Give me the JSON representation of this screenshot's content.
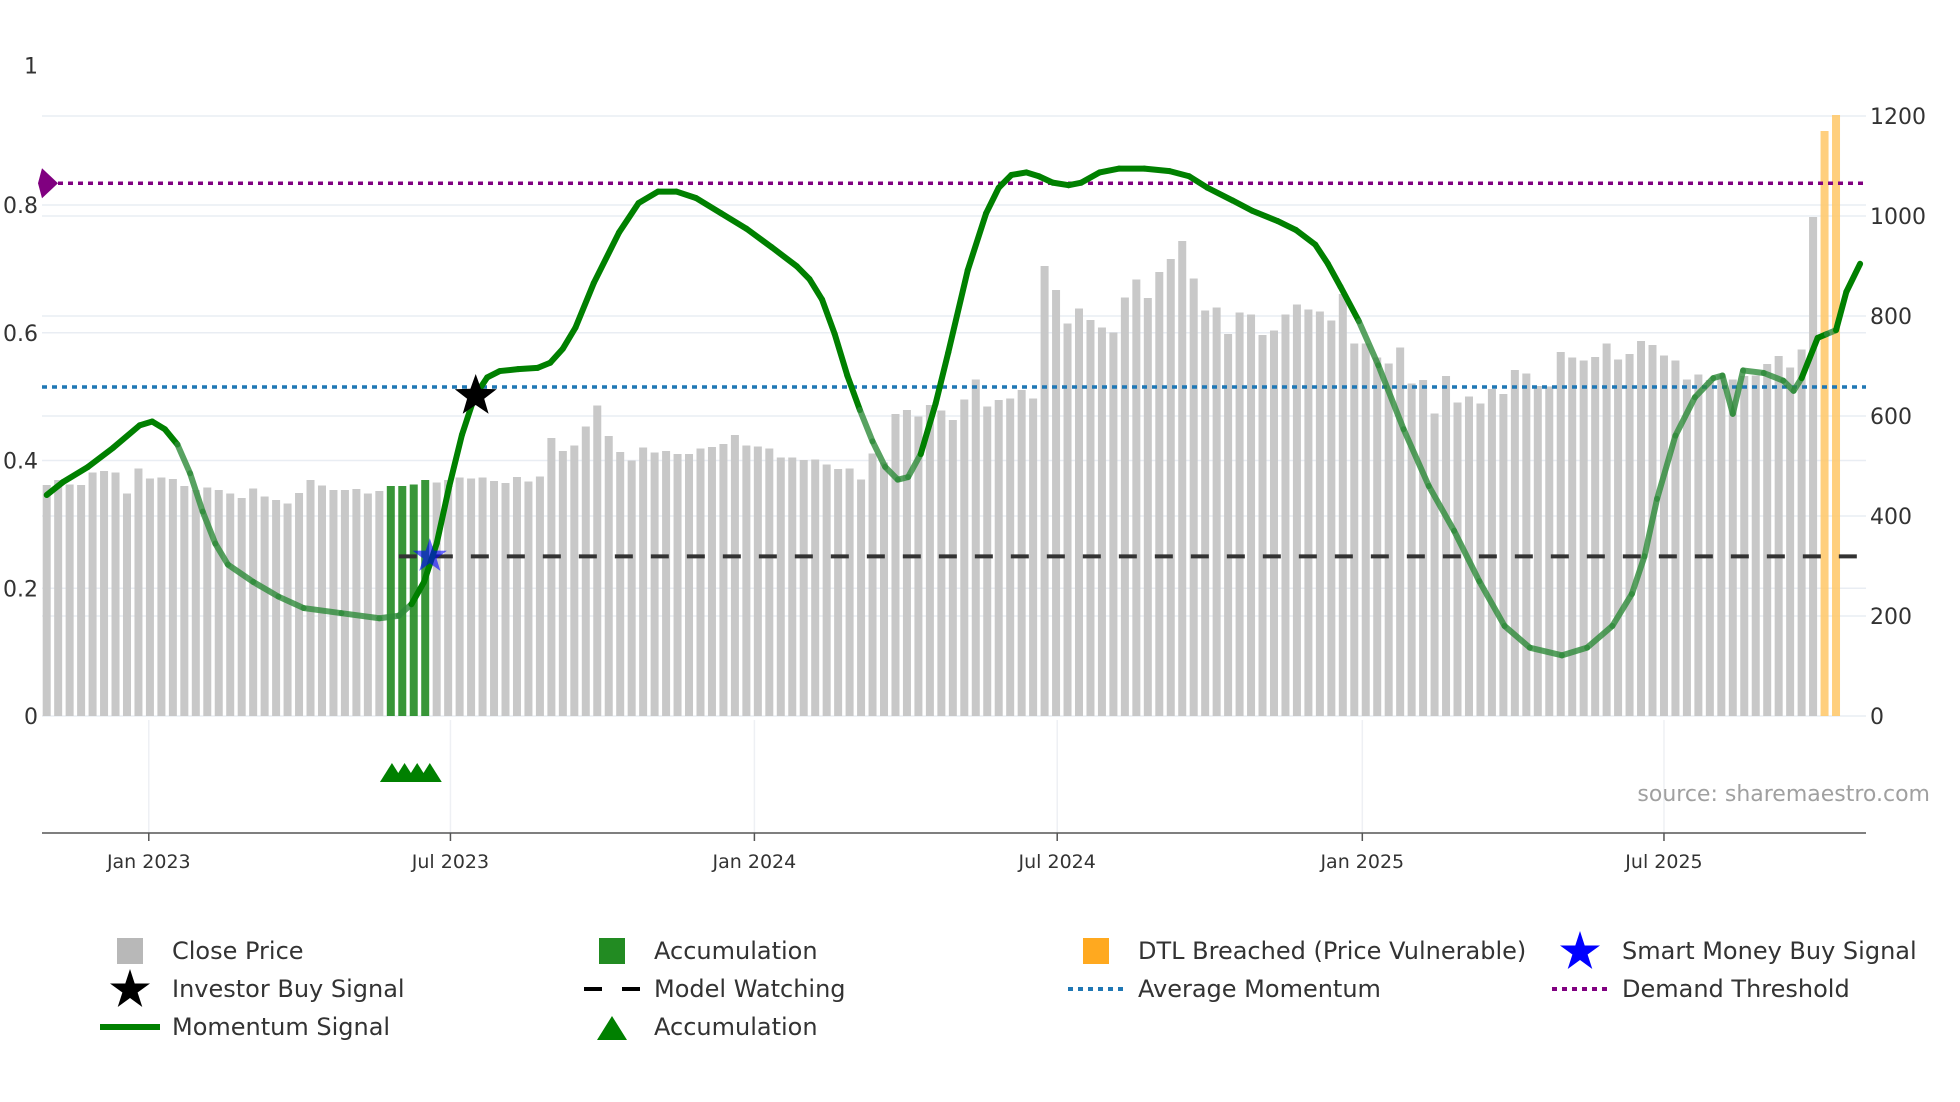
{
  "chart_data": {
    "type": "bar+line",
    "title": "",
    "left_axis": {
      "ticks": [
        "0",
        "0.2",
        "0.4",
        "0.6",
        "0.8",
        "1"
      ],
      "values": [
        0,
        0.2,
        0.4,
        0.6,
        0.8,
        1
      ],
      "range": [
        0,
        1
      ]
    },
    "right_axis": {
      "ticks": [
        "0",
        "200",
        "400",
        "600",
        "800",
        "1000",
        "1200"
      ],
      "values": [
        0,
        200,
        400,
        600,
        800,
        1000,
        1200
      ],
      "range": [
        0,
        1200
      ]
    },
    "x_ticks": [
      {
        "label": "Jan 2023",
        "week": 8.9
      },
      {
        "label": "Jul 2023",
        "week": 35.2
      },
      {
        "label": "Jan 2024",
        "week": 61.7
      },
      {
        "label": "Jul 2024",
        "week": 88.1
      },
      {
        "label": "Jan 2025",
        "week": 114.7
      },
      {
        "label": "Jul 2025",
        "week": 141
      }
    ],
    "close_price": [
      462,
      472,
      463,
      462,
      487,
      490,
      487,
      445,
      495,
      475,
      477,
      474,
      460,
      452,
      457,
      452,
      445,
      436,
      455,
      439,
      432,
      425,
      446,
      472,
      461,
      452,
      452,
      454,
      445,
      450,
      460,
      460,
      463,
      472,
      467,
      472,
      477,
      475,
      477,
      470,
      466,
      478,
      469,
      479,
      556,
      530,
      541,
      579,
      621,
      560,
      528,
      511,
      537,
      527,
      530,
      524,
      524,
      535,
      538,
      544,
      562,
      541,
      539,
      535,
      517,
      517,
      512,
      513,
      503,
      494,
      495,
      473,
      525,
      507,
      604,
      612,
      599,
      622,
      611,
      592,
      633,
      673,
      619,
      632,
      635,
      652,
      635,
      900,
      852,
      785,
      815,
      792,
      777,
      767,
      837,
      873,
      836,
      888,
      914,
      950,
      875,
      811,
      817,
      764,
      807,
      803,
      762,
      771,
      803,
      823,
      813,
      809,
      791,
      844,
      745,
      745,
      717,
      705,
      737,
      665,
      672,
      605,
      680,
      627,
      639,
      625,
      654,
      644,
      692,
      685,
      660,
      659,
      728,
      717,
      711,
      718,
      745,
      713,
      724,
      750,
      742,
      721,
      711,
      673,
      683,
      672,
      681,
      673,
      680,
      681,
      704,
      720,
      697,
      733,
      998,
      1170,
      1202
    ],
    "accumulation_bars": [
      30,
      31,
      32,
      33
    ],
    "dtl_breached_bars": [
      155,
      156
    ],
    "momentum_signal": [
      [
        0,
        0.346
      ],
      [
        1.4,
        0.366
      ],
      [
        3.6,
        0.39
      ],
      [
        5.8,
        0.42
      ],
      [
        8.1,
        0.455
      ],
      [
        9.2,
        0.461
      ],
      [
        10.3,
        0.449
      ],
      [
        11.4,
        0.425
      ],
      [
        12.5,
        0.38
      ],
      [
        13.6,
        0.32
      ],
      [
        14.7,
        0.27
      ],
      [
        15.8,
        0.237
      ],
      [
        18,
        0.21
      ],
      [
        20.2,
        0.187
      ],
      [
        22.4,
        0.169
      ],
      [
        25.7,
        0.161
      ],
      [
        29,
        0.153
      ],
      [
        30.7,
        0.157
      ],
      [
        31.8,
        0.175
      ],
      [
        32.9,
        0.21
      ],
      [
        34,
        0.27
      ],
      [
        35.1,
        0.36
      ],
      [
        36.2,
        0.44
      ],
      [
        37.3,
        0.5
      ],
      [
        38.4,
        0.53
      ],
      [
        39.5,
        0.54
      ],
      [
        41.1,
        0.543
      ],
      [
        42.8,
        0.545
      ],
      [
        43.9,
        0.553
      ],
      [
        45,
        0.575
      ],
      [
        46.1,
        0.608
      ],
      [
        47.7,
        0.678
      ],
      [
        49.9,
        0.757
      ],
      [
        51.6,
        0.803
      ],
      [
        53.3,
        0.821
      ],
      [
        54.9,
        0.821
      ],
      [
        56.6,
        0.811
      ],
      [
        58.8,
        0.787
      ],
      [
        61,
        0.763
      ],
      [
        63.2,
        0.734
      ],
      [
        65.4,
        0.704
      ],
      [
        66.5,
        0.684
      ],
      [
        67.6,
        0.652
      ],
      [
        68.7,
        0.598
      ],
      [
        69.8,
        0.533
      ],
      [
        70.9,
        0.479
      ],
      [
        72,
        0.43
      ],
      [
        73.1,
        0.39
      ],
      [
        74.2,
        0.37
      ],
      [
        75.1,
        0.374
      ],
      [
        76.2,
        0.41
      ],
      [
        77.5,
        0.489
      ],
      [
        78.6,
        0.569
      ],
      [
        80.3,
        0.698
      ],
      [
        81.9,
        0.787
      ],
      [
        83,
        0.827
      ],
      [
        84.1,
        0.847
      ],
      [
        85.4,
        0.851
      ],
      [
        86.5,
        0.845
      ],
      [
        87.7,
        0.835
      ],
      [
        89.1,
        0.831
      ],
      [
        90.2,
        0.835
      ],
      [
        91.8,
        0.851
      ],
      [
        93.5,
        0.857
      ],
      [
        95.7,
        0.857
      ],
      [
        97.9,
        0.853
      ],
      [
        99.6,
        0.845
      ],
      [
        101.2,
        0.827
      ],
      [
        103.4,
        0.807
      ],
      [
        105.1,
        0.791
      ],
      [
        107.3,
        0.775
      ],
      [
        108.9,
        0.761
      ],
      [
        110.6,
        0.738
      ],
      [
        111.7,
        0.708
      ],
      [
        112.8,
        0.672
      ],
      [
        114.4,
        0.618
      ],
      [
        116.1,
        0.549
      ],
      [
        118.3,
        0.449
      ],
      [
        120.5,
        0.36
      ],
      [
        122.7,
        0.29
      ],
      [
        124.9,
        0.211
      ],
      [
        127.1,
        0.141
      ],
      [
        129.3,
        0.107
      ],
      [
        132.1,
        0.095
      ],
      [
        134.3,
        0.107
      ],
      [
        136.5,
        0.141
      ],
      [
        138.2,
        0.191
      ],
      [
        139.3,
        0.25
      ],
      [
        140.4,
        0.34
      ],
      [
        142,
        0.439
      ],
      [
        143.7,
        0.499
      ],
      [
        145.3,
        0.529
      ],
      [
        146.1,
        0.533
      ],
      [
        147,
        0.473
      ],
      [
        147.9,
        0.541
      ],
      [
        149.7,
        0.537
      ],
      [
        151.4,
        0.525
      ],
      [
        152.3,
        0.509
      ],
      [
        153,
        0.529
      ],
      [
        154.4,
        0.592
      ],
      [
        155.2,
        0.598
      ],
      [
        156,
        0.604
      ],
      [
        156.9,
        0.664
      ],
      [
        158.1,
        0.708
      ]
    ],
    "momentum_faded_ranges": [
      [
        11.4,
        31.8
      ],
      [
        70.9,
        76.2
      ],
      [
        114.4,
        153
      ],
      [
        155.2,
        156
      ]
    ],
    "demand_threshold": 0.834,
    "average_momentum": 0.515,
    "model_watching": {
      "value": 0.25,
      "start_week": 30.7
    },
    "investor_buy_signals": [
      [
        37.4,
        0.501
      ]
    ],
    "smart_money_buy_signals": [
      [
        33.4,
        0.25
      ]
    ],
    "accumulation_markers": [
      30.1,
      31.2,
      32.3,
      33.4
    ],
    "annotation": "source: sharemaestro.com",
    "colors": {
      "close_price": "#c8c8c8",
      "accumulation": "#228b22",
      "dtl": "#ffc766",
      "momentum": "#008000",
      "average_momentum": "#1f77b4",
      "demand_threshold": "#800080",
      "model_watching": "#333333",
      "smart_money": "#0000ff",
      "investor": "#000000",
      "grid": "#e9edf3"
    },
    "legend": [
      {
        "label": "Close Price",
        "marker": "square",
        "color": "#b8b8b8"
      },
      {
        "label": "Investor Buy Signal",
        "marker": "star",
        "color": "#000000"
      },
      {
        "label": "Momentum Signal",
        "marker": "line",
        "color": "#008000"
      },
      {
        "label": "Accumulation",
        "marker": "square",
        "color": "#228b22"
      },
      {
        "label": "Model Watching",
        "marker": "dash",
        "color": "#000000"
      },
      {
        "label": "Accumulation",
        "marker": "triangle",
        "color": "#008000"
      },
      {
        "label": "DTL Breached (Price Vulnerable)",
        "marker": "square",
        "color": "#ffa91f"
      },
      {
        "label": "Average Momentum",
        "marker": "dot",
        "color": "#1f77b4"
      },
      {
        "label": "Smart Money Buy Signal",
        "marker": "star",
        "color": "#0000ff"
      },
      {
        "label": "Demand Threshold",
        "marker": "dot",
        "color": "#800080"
      }
    ]
  }
}
